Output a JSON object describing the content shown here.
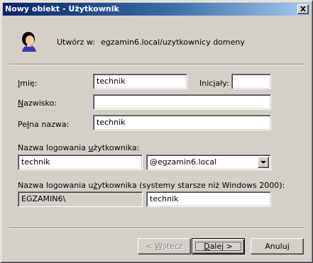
{
  "window": {
    "title": "Nowy obiekt - Użytkownik"
  },
  "header": {
    "icon": "user-icon",
    "create_in_label": "Utwórz w:",
    "create_in_path": "egzamin6.local/uzytkownicy domeny"
  },
  "form": {
    "first_name": {
      "label_hotkey": "I",
      "label_rest": "mię:",
      "value": "technik"
    },
    "initials": {
      "label_pre": "Inic",
      "label_hotkey": "j",
      "label_rest": "ały:",
      "value": ""
    },
    "last_name": {
      "label_hotkey": "N",
      "label_rest": "azwisko:",
      "value": ""
    },
    "full_name": {
      "label_pre": "Pe",
      "label_hotkey": "ł",
      "label_rest": "na nazwa:",
      "value": "technik"
    },
    "logon_name": {
      "label_pre": "Nazwa logowania ",
      "label_hotkey": "u",
      "label_rest": "żytkownika:",
      "value": "technik",
      "domain_suffix": "@egzamin6.local"
    },
    "pre2000_logon": {
      "label_pre": "Nazwa logowania u",
      "label_hotkey": "ż",
      "label_rest": "ytkownika (systemy starsze niż Windows 2000):",
      "domain": "EGZAMIN6\\",
      "value": "technik"
    }
  },
  "buttons": {
    "back": {
      "pre": "< ",
      "hotkey": "W",
      "rest": "stecz"
    },
    "next": {
      "hotkey": "D",
      "rest": "alej >"
    },
    "cancel": "Anuluj"
  },
  "colors": {
    "title_gradient_start": "#0a246a",
    "title_gradient_end": "#a6caf0",
    "face": "#d4d0c8"
  }
}
